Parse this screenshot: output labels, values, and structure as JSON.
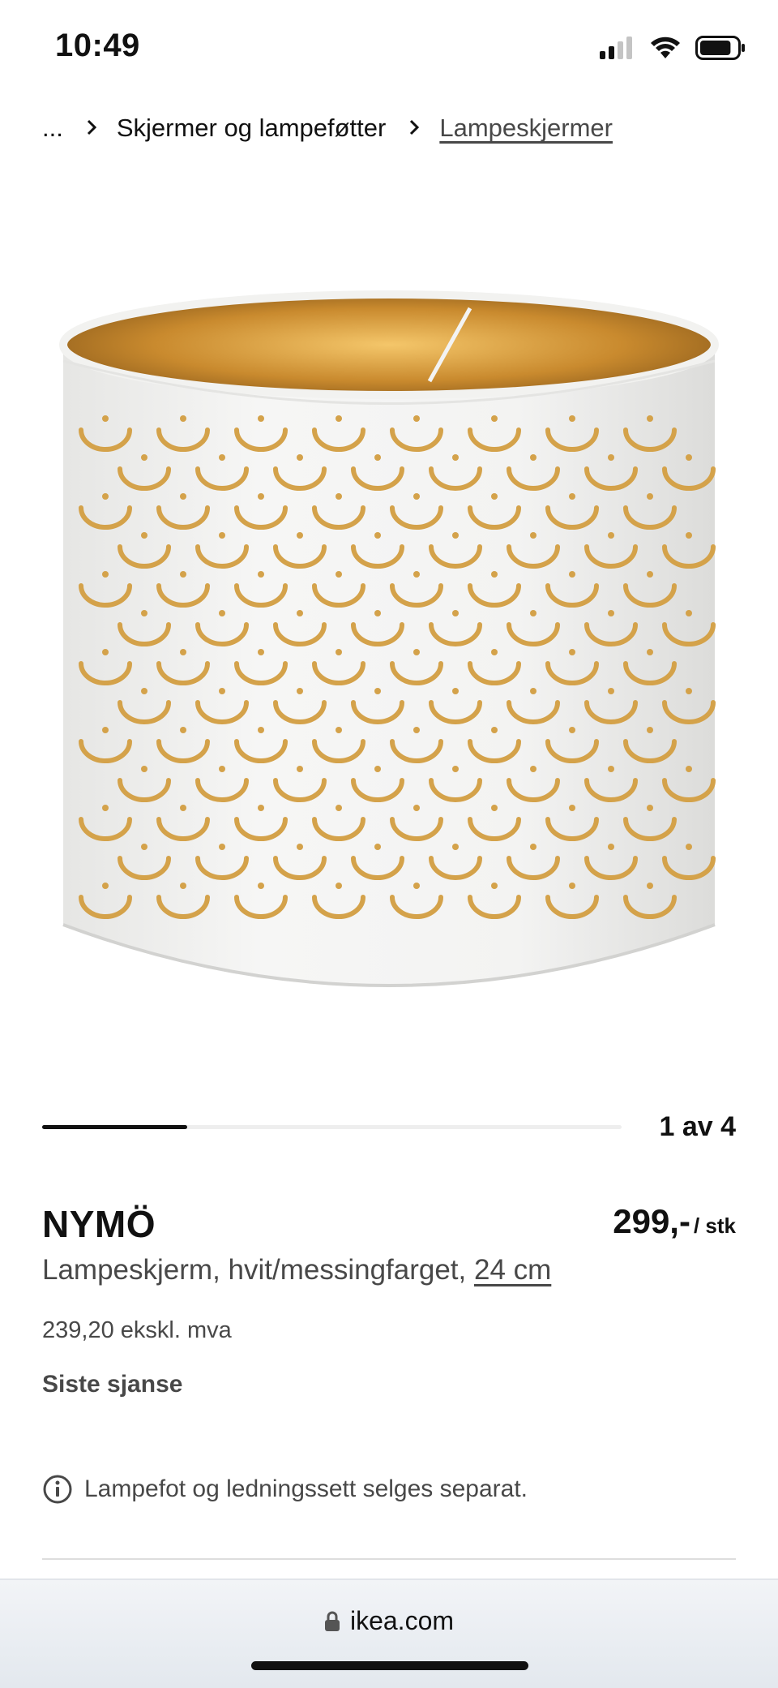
{
  "status_bar": {
    "time": "10:49",
    "battery_level": 0.85
  },
  "breadcrumb": {
    "ellipsis": "...",
    "items": [
      "Skjermer og lampeføtter",
      "Lampeskjermer"
    ]
  },
  "product": {
    "name": "NYMÖ",
    "description": "Lampeskjerm, hvit/messingfarget, ",
    "size": "24 cm",
    "price": "299,-",
    "price_unit": "/ stk",
    "price_excl_vat": "239,20 ekskl. mva",
    "badge": "Siste sjanse",
    "info_note": "Lampefot og ledningssett selges separat."
  },
  "carousel": {
    "counter": "1 av 4",
    "current": 1,
    "total": 4
  },
  "browser": {
    "url": "ikea.com"
  },
  "colors": {
    "accent": "#111111",
    "text_secondary": "#484848",
    "brass": "#d4a24a"
  }
}
